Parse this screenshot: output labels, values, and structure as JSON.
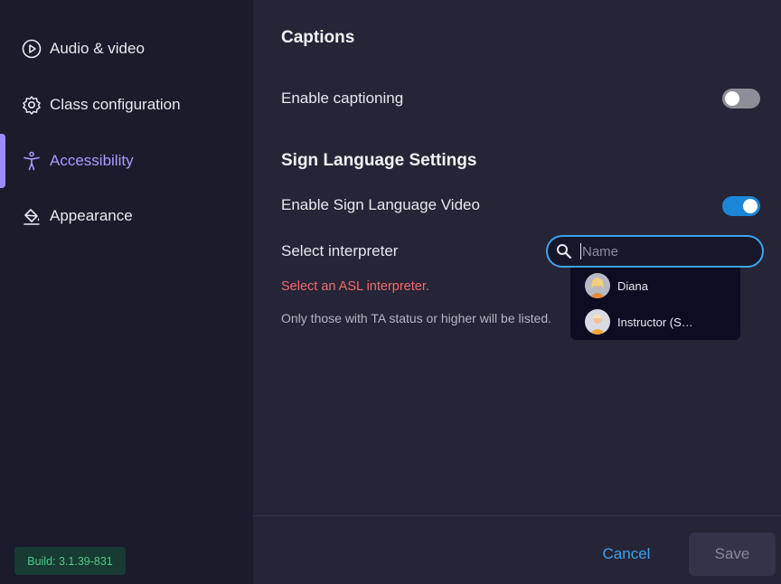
{
  "sidebar": {
    "items": [
      {
        "label": "Audio & video",
        "icon": "play-circle-icon"
      },
      {
        "label": "Class configuration",
        "icon": "gear-icon"
      },
      {
        "label": "Accessibility",
        "icon": "accessibility-icon",
        "active": true
      },
      {
        "label": "Appearance",
        "icon": "paint-bucket-icon"
      }
    ],
    "build": "Build: 3.1.39-831"
  },
  "captions": {
    "heading": "Captions",
    "enable_label": "Enable captioning",
    "enabled": false
  },
  "sign_language": {
    "heading": "Sign Language Settings",
    "enable_label": "Enable Sign Language Video",
    "enabled": true,
    "select_label": "Select interpreter",
    "search_placeholder": "Name",
    "search_value": "",
    "options": [
      {
        "name": "Diana"
      },
      {
        "name": "Instructor (S…"
      }
    ],
    "error": "Select an ASL interpreter.",
    "hint": "Only those with TA status or higher will be listed."
  },
  "footer": {
    "cancel": "Cancel",
    "save": "Save"
  },
  "colors": {
    "accent": "#9c8cff",
    "link": "#3ea1ee",
    "toggle_on": "#1c86d8",
    "error": "#f06a6a"
  }
}
